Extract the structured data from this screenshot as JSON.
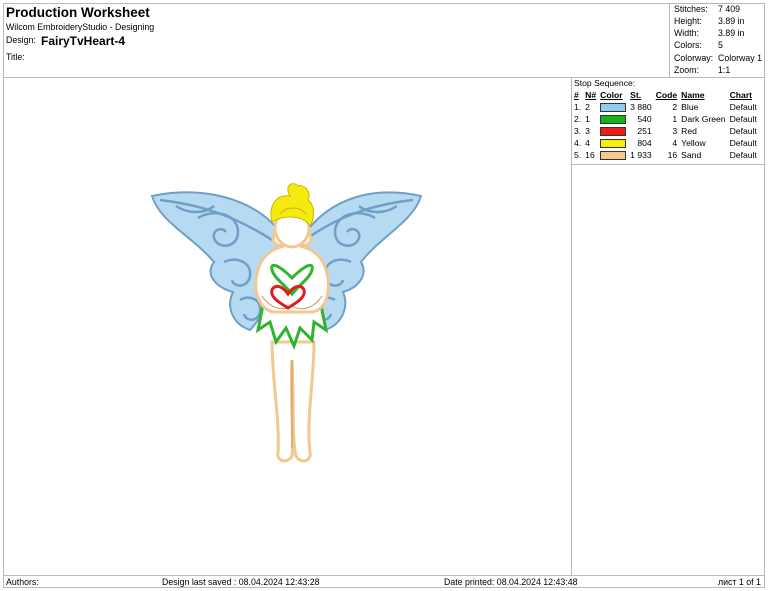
{
  "header": {
    "title": "Production Worksheet",
    "subtitle": "Wilcom EmbroideryStudio - Designing",
    "design_label": "Design:",
    "design_name": "FairyTvHeart-4",
    "title_label": "Title:"
  },
  "stats": [
    {
      "label": "Stitches:",
      "value": "7 409"
    },
    {
      "label": "Height:",
      "value": "3.89 in"
    },
    {
      "label": "Width:",
      "value": "3.89 in"
    },
    {
      "label": "Colors:",
      "value": "5"
    },
    {
      "label": "Colorway:",
      "value": "Colorway 1"
    },
    {
      "label": "Zoom:",
      "value": "1:1"
    }
  ],
  "stop_sequence": {
    "label": "Stop Sequence:",
    "headers": [
      "#",
      "N#",
      "Color",
      "St.",
      "Code",
      "Name",
      "Chart"
    ],
    "rows": [
      {
        "num": "1.",
        "n": "2",
        "color": "#8ecdf2",
        "st": "3 880",
        "code": "2",
        "name": "Blue",
        "chart": "Default"
      },
      {
        "num": "2.",
        "n": "1",
        "color": "#12b31b",
        "st": "540",
        "code": "1",
        "name": "Dark Green",
        "chart": "Default"
      },
      {
        "num": "3.",
        "n": "3",
        "color": "#ee1c1c",
        "st": "251",
        "code": "3",
        "name": "Red",
        "chart": "Default"
      },
      {
        "num": "4.",
        "n": "4",
        "color": "#f7ee0c",
        "st": "804",
        "code": "4",
        "name": "Yellow",
        "chart": "Default"
      },
      {
        "num": "5.",
        "n": "16",
        "color": "#f6c98e",
        "st": "1 933",
        "code": "16",
        "name": "Sand",
        "chart": "Default"
      }
    ]
  },
  "footer": {
    "authors": "Authors:",
    "last_saved": "Design last saved : 08.04.2024 12:43:28",
    "printed": "Date printed: 08.04.2024 12:43:48",
    "page": "лист 1 of 1"
  },
  "colors": {
    "wing_fill": "#b7daf3",
    "wing_stroke": "#6f9fc8",
    "hair": "#f5ea10",
    "hair_stroke": "#c8b800",
    "dress": "#2fb52d",
    "heart": "#e31b1b",
    "body": "#f2c890",
    "body_stroke": "#c9955a"
  }
}
